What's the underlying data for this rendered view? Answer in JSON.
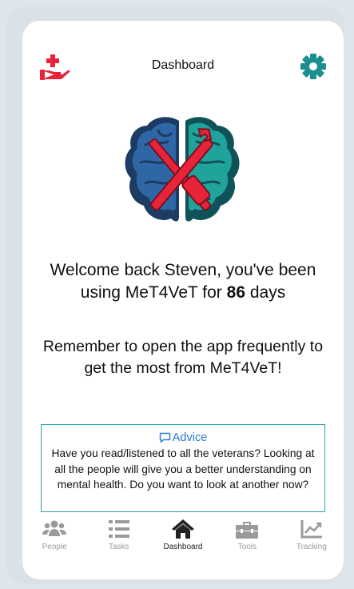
{
  "header": {
    "title": "Dashboard",
    "left_icon": "hand-holding-medical-icon",
    "right_icon": "gear-icon",
    "accent_red": "#e8243a",
    "accent_teal": "#1a8f8f"
  },
  "main": {
    "welcome_prefix": "Welcome back Steven, you've been using MeT4VeT for",
    "days_count": "86",
    "welcome_suffix": "days",
    "reminder": "Remember to open the app frequently to get the most from MeT4VeT!"
  },
  "advice": {
    "heading": "Advice",
    "body": "Have you read/listened to all the veterans? Looking at all the people will give you a better understanding on mental health. Do you want to look at another now?"
  },
  "tabs": [
    {
      "label": "People",
      "icon": "people-icon",
      "active": false
    },
    {
      "label": "Tasks",
      "icon": "list-icon",
      "active": false
    },
    {
      "label": "Dashboard",
      "icon": "home-icon",
      "active": true
    },
    {
      "label": "Tools",
      "icon": "toolbox-icon",
      "active": false
    },
    {
      "label": "Tracking",
      "icon": "chart-line-icon",
      "active": false
    }
  ]
}
